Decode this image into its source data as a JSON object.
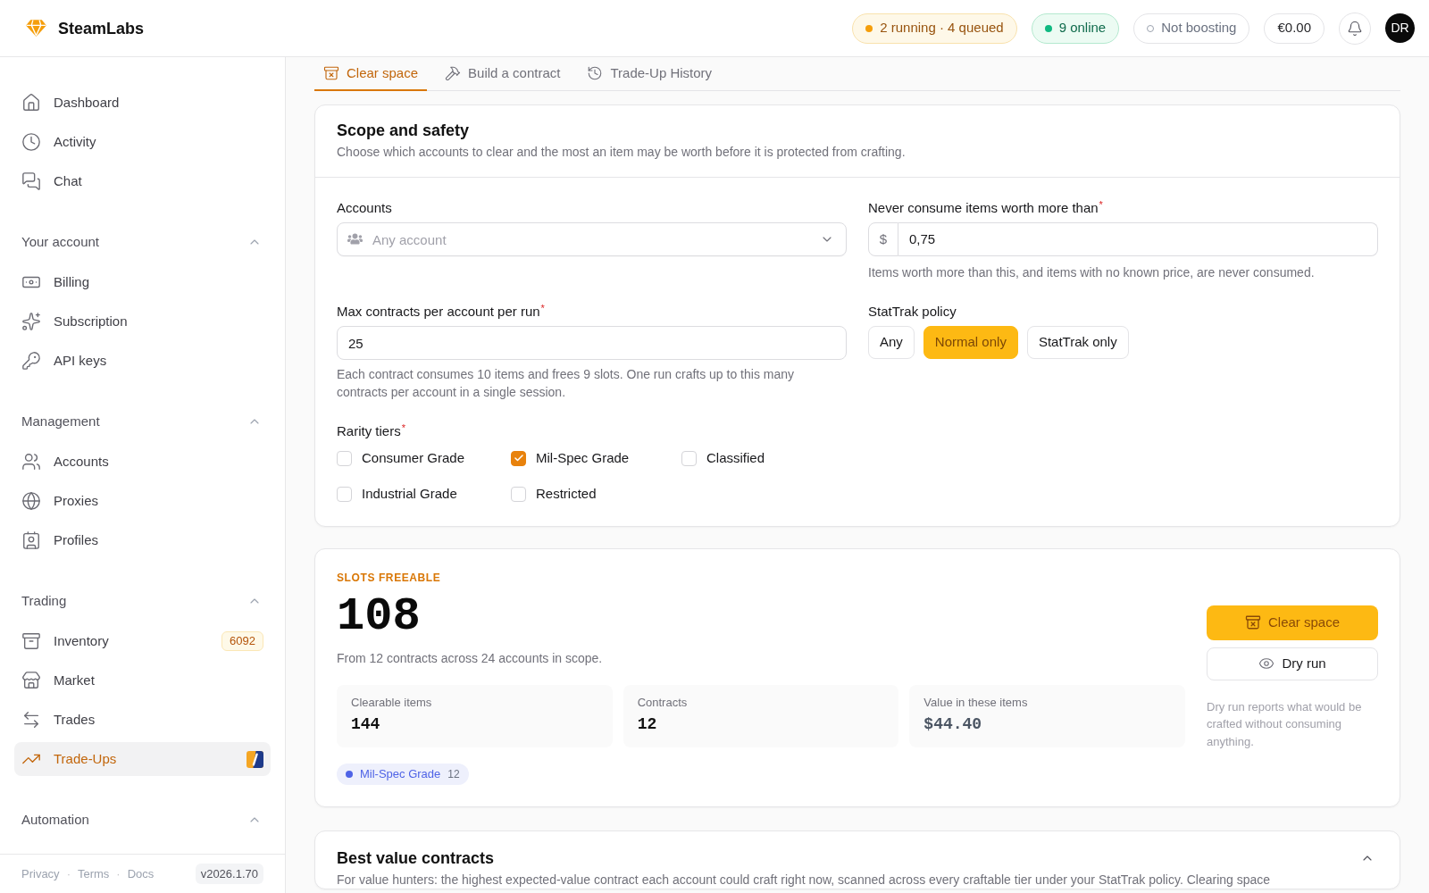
{
  "header": {
    "brand": "SteamLabs",
    "statuses": [
      {
        "kind": "busy",
        "label": "2 running · 4 queued"
      },
      {
        "kind": "online",
        "label": "9 online"
      },
      {
        "kind": "idle",
        "label": "Not boosting"
      }
    ],
    "balance": "€0.00",
    "avatar": "DR"
  },
  "sidebar": {
    "items": [
      {
        "label": "Dashboard",
        "selected": false
      },
      {
        "label": "Activity",
        "selected": false
      },
      {
        "label": "Chat",
        "selected": false
      }
    ],
    "sections": [
      {
        "title": "Your account",
        "expanded": true,
        "items": [
          {
            "label": "Billing",
            "selected": false
          },
          {
            "label": "Subscription",
            "selected": false
          },
          {
            "label": "API keys",
            "selected": false
          }
        ]
      },
      {
        "title": "Management",
        "expanded": true,
        "items": [
          {
            "label": "Accounts",
            "selected": false
          },
          {
            "label": "Proxies",
            "selected": false
          },
          {
            "label": "Profiles",
            "selected": false
          }
        ]
      },
      {
        "title": "Trading",
        "expanded": true,
        "items": [
          {
            "label": "Inventory",
            "selected": false,
            "badge": "6092",
            "sticker": false
          },
          {
            "label": "Market",
            "selected": false,
            "sticker": false
          },
          {
            "label": "Trades",
            "selected": false,
            "sticker": false
          },
          {
            "label": "Trade-Ups",
            "selected": true,
            "sticker": true
          }
        ]
      },
      {
        "title": "Automation",
        "expanded": true
      }
    ],
    "footer": {
      "items": [
        {
          "kind": "link",
          "label": "Privacy"
        },
        {
          "kind": "separator",
          "label": "·"
        },
        {
          "kind": "link",
          "label": "Terms"
        },
        {
          "kind": "separator",
          "label": "·"
        },
        {
          "kind": "link",
          "label": "Docs"
        }
      ],
      "version": "v2026.1.70"
    }
  },
  "tabs": [
    {
      "label": "Clear space",
      "selected": true
    },
    {
      "label": "Build a contract",
      "selected": false
    },
    {
      "label": "Trade-Up History",
      "selected": false
    }
  ],
  "scope": {
    "title": "Scope and safety",
    "description": "Choose which accounts to clear and the most an item may be worth before it is protected from crafting.",
    "accounts": {
      "label": "Accounts",
      "placeholder": "Any account"
    },
    "max_value": {
      "label": "Never consume items worth more than",
      "required_mark": "*",
      "prefix": "$",
      "value": "0,75",
      "help": "Items worth more than this, and items with no known price, are never consumed."
    },
    "max_contracts": {
      "label": "Max contracts per account per run",
      "required_mark": "*",
      "value": "25",
      "help": "Each contract consumes 10 items and frees 9 slots. One run crafts up to this many contracts per account in a single session."
    },
    "stattrak_policy": {
      "label": "StatTrak policy",
      "options": [
        {
          "label": "Any",
          "selected": false
        },
        {
          "label": "Normal only",
          "selected": true
        },
        {
          "label": "StatTrak only",
          "selected": false
        }
      ]
    },
    "rarity_tiers": {
      "label": "Rarity tiers",
      "required_mark": "*",
      "options": [
        {
          "label": "Consumer Grade",
          "checked": false
        },
        {
          "label": "Industrial Grade",
          "checked": false
        },
        {
          "label": "Mil-Spec Grade",
          "checked": true
        },
        {
          "label": "Restricted",
          "checked": false
        },
        {
          "label": "Classified",
          "checked": false
        }
      ]
    }
  },
  "slots": {
    "eyebrow": "SLOTS FREEABLE",
    "value": "108",
    "summary": "From 12 contracts across 24 accounts in scope.",
    "stats": [
      {
        "label": "Clearable items",
        "value": "144",
        "muted": false
      },
      {
        "label": "Contracts",
        "value": "12",
        "muted": false
      },
      {
        "label": "Value in these items",
        "value": "$44.40",
        "muted": true
      }
    ],
    "tiers": [
      {
        "label": "Mil-Spec Grade",
        "count": "12",
        "color": "#4f63e6"
      }
    ],
    "primary_action": "Clear space",
    "secondary_action": "Dry run",
    "note": "Dry run reports what would be crafted without consuming anything."
  },
  "best_value": {
    "title": "Best value contracts",
    "expanded": true,
    "description": "For value hunters: the highest expected-value contract each account could craft right now, scanned across every craftable tier under your StatTrak policy. Clearing space"
  }
}
